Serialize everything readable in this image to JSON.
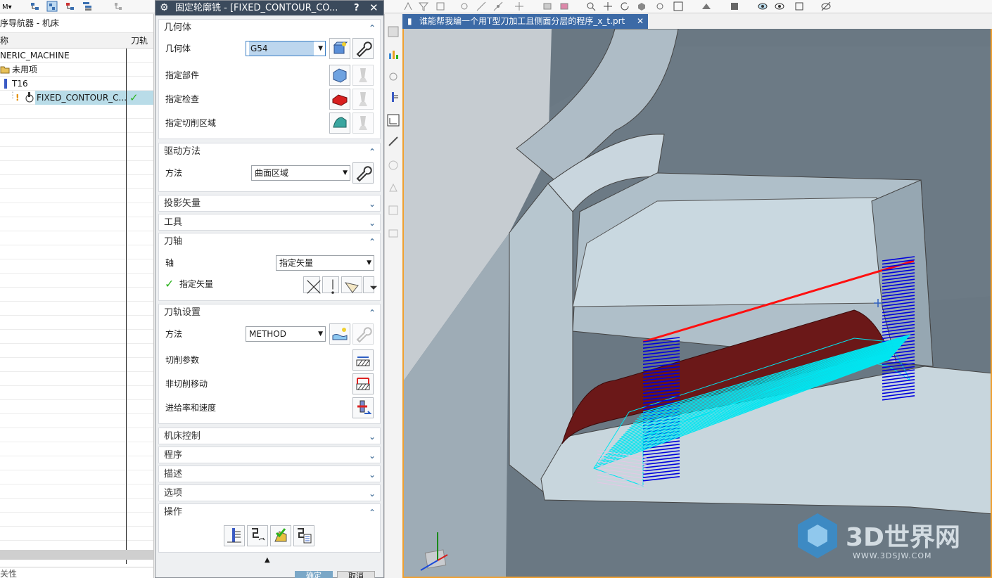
{
  "navigator": {
    "title": "序导航器 - 机床",
    "col_name": "称",
    "col_path": "刀轨",
    "rows": [
      {
        "label": "NERIC_MACHINE"
      },
      {
        "label": "未用项"
      },
      {
        "label": "T16"
      },
      {
        "label": "FIXED_CONTOUR_C...",
        "mark": "!",
        "status": "✓"
      }
    ],
    "footer": "关性"
  },
  "dialog": {
    "title": "固定轮廓铣 - [FIXED_CONTOUR_CO...",
    "help": "?",
    "sections": {
      "geometry": {
        "header": "几何体",
        "geom_label": "几何体",
        "geom_value": "G54",
        "part_label": "指定部件",
        "check_label": "指定检查",
        "cut_area_label": "指定切削区域"
      },
      "drive": {
        "header": "驱动方法",
        "method_label": "方法",
        "method_value": "曲面区域"
      },
      "projection": {
        "header": "投影矢量"
      },
      "tool": {
        "header": "工具"
      },
      "axis": {
        "header": "刀轴",
        "axis_label": "轴",
        "axis_value": "指定矢量",
        "vector_label": "指定矢量"
      },
      "path": {
        "header": "刀轨设置",
        "method_label": "方法",
        "method_value": "METHOD",
        "cut_params": "切削参数",
        "non_cut": "非切削移动",
        "feeds": "进给率和速度"
      },
      "machine": {
        "header": "机床控制"
      },
      "program": {
        "header": "程序"
      },
      "description": {
        "header": "描述"
      },
      "options": {
        "header": "选项"
      },
      "actions": {
        "header": "操作"
      }
    },
    "ok": "确定",
    "cancel": "取消"
  },
  "viewport": {
    "tab_title": "谁能帮我编一个用T型刀加工且侧面分层的程序_x_t.prt",
    "watermark_big": "3D世界网",
    "watermark_small": "WWW.3DSJW.COM"
  },
  "colors": {
    "dialog_title_bg": "#3b4a5c",
    "tab_active": "#3c6aa6",
    "viewport_border": "#f0a030",
    "toolpath_cyan": "#00e5f0",
    "toolpath_blue": "#0000dd",
    "toolpath_red": "#ff1010",
    "part_dark_red": "#6b1818"
  }
}
